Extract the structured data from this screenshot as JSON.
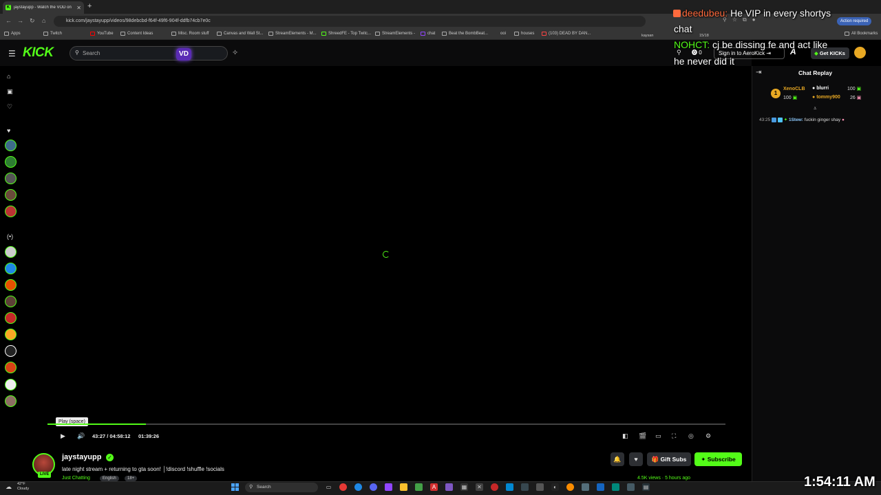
{
  "browser": {
    "tab_title": "jaystayupp - Watch the VOD on",
    "url": "kick.com/jaystayupp/videos/98debcbd-f64f-49f6-904f-ddfb74cb7e0c",
    "action_required": "Action required",
    "bookmarks": [
      "Apps",
      "Twitch",
      "YouTube",
      "Content Ideas",
      "Misc. Room stuff",
      "Canvas and Wall St...",
      "StreamElements - M...",
      "ShreedFE - Top Twitc...",
      "StreamElements -",
      "chat",
      "Beat the BombBeat...",
      "ooi",
      "houses",
      "(103) DEAD BY DAN...",
      "All Bookmarks"
    ]
  },
  "kick": {
    "logo": "KICK",
    "search_placeholder": "Search",
    "vd_badge": "VD",
    "points": "0",
    "sign_in": "Sign in to AeroKick",
    "get_kicks": "Get KICKs"
  },
  "player": {
    "tooltip": "Play (space)",
    "time_current": "43:27 / 04:58:12",
    "time_remaining": "01:39:26",
    "progress": 0.145
  },
  "stream": {
    "channel": "jaystayupp",
    "live_badge": "LIVE",
    "title": "late night stream + returning to gta soon! │!discord !shuffle !socials",
    "category": "Just Chatting",
    "tags": [
      "English",
      "18+"
    ],
    "views": "4.5K views · 5 hours ago",
    "gift_subs": "Gift Subs",
    "subscribe": "Subscribe"
  },
  "chat": {
    "header": "Chat Replay",
    "top_gifters": [
      {
        "rank": "1",
        "name": "XenoCLB",
        "amount": "100"
      },
      {
        "name": "blurri",
        "amount": "100"
      },
      {
        "name": "tommy900",
        "amount": "26"
      }
    ],
    "messages": [
      {
        "time": "43:25",
        "user": "1Stew:",
        "text": "fuckin ginger shay"
      }
    ]
  },
  "overlay": {
    "lines": [
      {
        "user": "deedubeu:",
        "text": "He VIP in every shortys"
      },
      {
        "user": "",
        "text": "chat"
      },
      {
        "user": "NOHCT:",
        "text": "cj be dissing fe and act like"
      },
      {
        "user": "",
        "text": "he never did it"
      }
    ],
    "counter": "15/18",
    "viewer_name": "kaysan"
  },
  "taskbar": {
    "temperature": "42°F",
    "condition": "Cloudy",
    "search": "Search",
    "clock": "1:54:11 AM"
  },
  "colors": {
    "brand_green": "#53fc18",
    "bg": "#000000",
    "panel": "#0b0b0c"
  }
}
